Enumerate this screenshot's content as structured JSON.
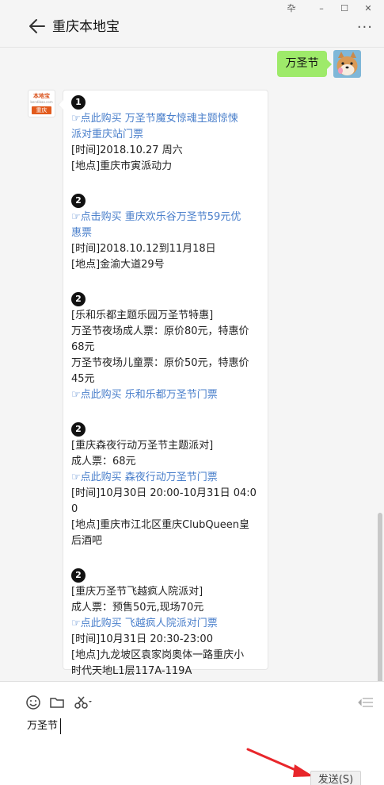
{
  "window": {
    "controls": [
      "卆",
      "–",
      "☐",
      "✕"
    ]
  },
  "header": {
    "title": "重庆本地宝",
    "more": "···"
  },
  "messages": {
    "self_message": "万圣节",
    "bot_avatar": {
      "top": "本地宝",
      "mid": "bendibao.com",
      "bottom": "重庆"
    },
    "bot_lines": [
      {
        "type": "num",
        "text": "1"
      },
      {
        "type": "link",
        "text": "☞点此购买 万圣节魔女惊魂主题惊悚"
      },
      {
        "type": "link",
        "text": "派对重庆站门票"
      },
      {
        "type": "text",
        "text": "[时间]2018.10.27 周六"
      },
      {
        "type": "text",
        "text": "[地点]重庆市寅派动力"
      },
      {
        "type": "gap"
      },
      {
        "type": "num",
        "text": "2"
      },
      {
        "type": "link",
        "text": "☞点击购买 重庆欢乐谷万圣节59元优"
      },
      {
        "type": "link",
        "text": "惠票"
      },
      {
        "type": "text",
        "text": "[时间]2018.10.12到11月18日"
      },
      {
        "type": "text",
        "text": "[地点]金渝大道29号"
      },
      {
        "type": "gap"
      },
      {
        "type": "num",
        "text": "2"
      },
      {
        "type": "text",
        "text": "[乐和乐都主题乐园万圣节特惠]"
      },
      {
        "type": "text",
        "text": "万圣节夜场成人票：原价80元，特惠价"
      },
      {
        "type": "text",
        "text": "68元"
      },
      {
        "type": "text",
        "text": "万圣节夜场儿童票：原价50元，特惠价"
      },
      {
        "type": "text",
        "text": "45元"
      },
      {
        "type": "link",
        "text": "☞点此购买 乐和乐都万圣节门票"
      },
      {
        "type": "gap"
      },
      {
        "type": "num",
        "text": "2"
      },
      {
        "type": "text",
        "text": "[重庆森夜行动万圣节主题派对]"
      },
      {
        "type": "text",
        "text": "成人票：68元"
      },
      {
        "type": "link",
        "text": "☞点此购买 森夜行动万圣节门票"
      },
      {
        "type": "text",
        "text": "[时间]10月30日 20:00-10月31日 04:0"
      },
      {
        "type": "text",
        "text": "0"
      },
      {
        "type": "text",
        "text": "[地点]重庆市江北区重庆ClubQueen皇"
      },
      {
        "type": "text",
        "text": "后酒吧"
      },
      {
        "type": "gap"
      },
      {
        "type": "num",
        "text": "2"
      },
      {
        "type": "text",
        "text": "[重庆万圣节飞越疯人院派对]"
      },
      {
        "type": "text",
        "text": "成人票：预售50元,现场70元"
      },
      {
        "type": "link",
        "text": "☞点此购买 飞越疯人院派对门票"
      },
      {
        "type": "text",
        "text": "[时间]10月31日 20:30-23:00"
      },
      {
        "type": "text",
        "text": "[地点]九龙坡区袁家岗奥体一路重庆小"
      },
      {
        "type": "text",
        "text": "时代天地L1层117A-119A"
      }
    ]
  },
  "input": {
    "text": "万圣节",
    "send_label": "发送(S)"
  },
  "colors": {
    "self_bubble": "#9eea6a",
    "link": "#4a7fcb",
    "annotation_arrow": "#e8262b"
  }
}
